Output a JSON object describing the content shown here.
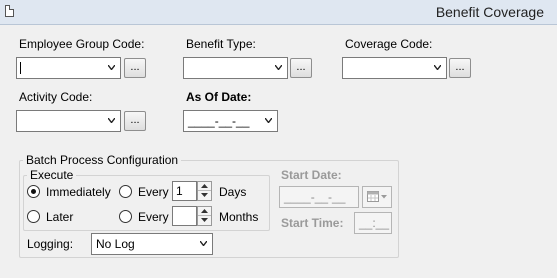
{
  "window": {
    "title": "Benefit Coverage",
    "icon": "document-icon"
  },
  "fields": {
    "employee_group_code": {
      "label": "Employee Group Code:",
      "value": "",
      "lookup_label": "..."
    },
    "benefit_type": {
      "label": "Benefit Type:",
      "value": "",
      "lookup_label": "..."
    },
    "coverage_code": {
      "label": "Coverage Code:",
      "value": "",
      "lookup_label": "..."
    },
    "activity_code": {
      "label": "Activity Code:",
      "value": "",
      "lookup_label": "..."
    },
    "as_of_date": {
      "label": "As Of Date:",
      "value": "____-__-__"
    }
  },
  "batch": {
    "legend": "Batch Process Configuration",
    "execute": {
      "legend": "Execute",
      "immediately_label": "Immediately",
      "later_label": "Later",
      "every_label": "Every",
      "every_days_value": "1",
      "days_label": "Days",
      "every_months_value": "",
      "months_label": "Months",
      "selected": "Immediately"
    },
    "start_date": {
      "label": "Start Date:",
      "value": "____-__-__"
    },
    "start_time": {
      "label": "Start Time:",
      "value": "__:__"
    },
    "logging": {
      "label": "Logging:",
      "value": "No Log"
    }
  }
}
